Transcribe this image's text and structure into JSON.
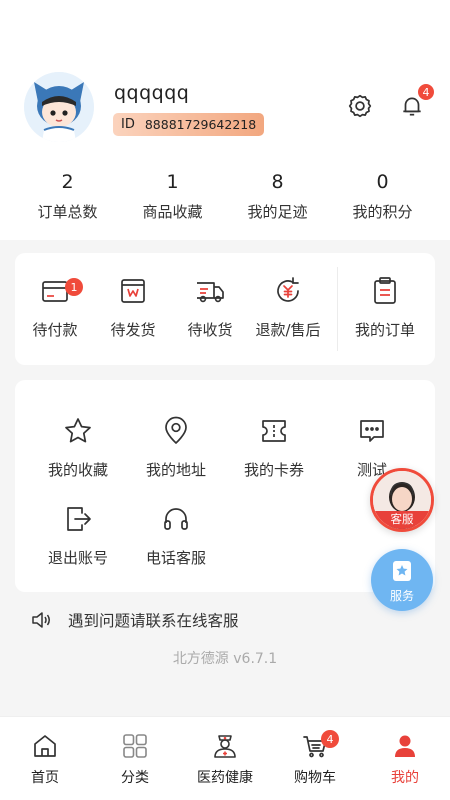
{
  "profile": {
    "username": "qqqqqq",
    "id_label": "ID",
    "id_value": "88881729642218",
    "notification_count": "4"
  },
  "stats": [
    {
      "value": "2",
      "label": "订单总数"
    },
    {
      "value": "1",
      "label": "商品收藏"
    },
    {
      "value": "8",
      "label": "我的足迹"
    },
    {
      "value": "0",
      "label": "我的积分"
    }
  ],
  "orders": [
    {
      "label": "待付款",
      "icon": "wallet-icon",
      "badge": "1"
    },
    {
      "label": "待发货",
      "icon": "package-icon"
    },
    {
      "label": "待收货",
      "icon": "truck-icon"
    },
    {
      "label": "退款/售后",
      "icon": "refund-icon"
    },
    {
      "label": "我的订单",
      "icon": "clipboard-icon"
    }
  ],
  "services": [
    {
      "label": "我的收藏",
      "icon": "star-icon"
    },
    {
      "label": "我的地址",
      "icon": "location-icon"
    },
    {
      "label": "我的卡券",
      "icon": "ticket-icon"
    },
    {
      "label": "测试",
      "icon": "message-icon"
    },
    {
      "label": "退出账号",
      "icon": "logout-icon"
    },
    {
      "label": "电话客服",
      "icon": "headset-icon"
    }
  ],
  "notice": {
    "text": "遇到问题请联系在线客服",
    "icon": "speaker-icon"
  },
  "version": "北方德源 v6.7.1",
  "floating": {
    "customer_service_label": "客服",
    "service_label": "服务"
  },
  "tabs": [
    {
      "label": "首页",
      "icon": "home-icon"
    },
    {
      "label": "分类",
      "icon": "grid-icon"
    },
    {
      "label": "医药健康",
      "icon": "nurse-icon"
    },
    {
      "label": "购物车",
      "icon": "cart-icon",
      "badge": "4"
    },
    {
      "label": "我的",
      "icon": "user-icon",
      "active": true
    }
  ],
  "colors": {
    "accent": "#e8413a",
    "badge": "#f04b3b",
    "service_blue": "#6fb6f2",
    "id_badge": "#f2a77f"
  }
}
